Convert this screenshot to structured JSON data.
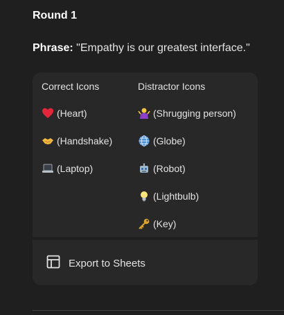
{
  "round": {
    "title": "Round 1"
  },
  "phrase": {
    "label": "Phrase:",
    "text": "\"Empathy is our greatest interface.\""
  },
  "table": {
    "headers": [
      "Correct Icons",
      "Distractor Icons"
    ],
    "correct": [
      {
        "icon": "heart-icon",
        "label": "(Heart)"
      },
      {
        "icon": "handshake-icon",
        "label": "(Handshake)"
      },
      {
        "icon": "laptop-icon",
        "label": "(Laptop)"
      }
    ],
    "distractor": [
      {
        "icon": "shrugging-person-icon",
        "label": "(Shrugging person)"
      },
      {
        "icon": "globe-icon",
        "label": "(Globe)"
      },
      {
        "icon": "robot-icon",
        "label": "(Robot)"
      },
      {
        "icon": "lightbulb-icon",
        "label": "(Lightbulb)"
      },
      {
        "icon": "key-icon",
        "label": "(Key)"
      }
    ]
  },
  "export": {
    "label": "Export to Sheets",
    "icon": "table-icon"
  },
  "colors": {
    "background": "#1f1f1f",
    "card": "#282828",
    "text": "#e3e3e3"
  }
}
